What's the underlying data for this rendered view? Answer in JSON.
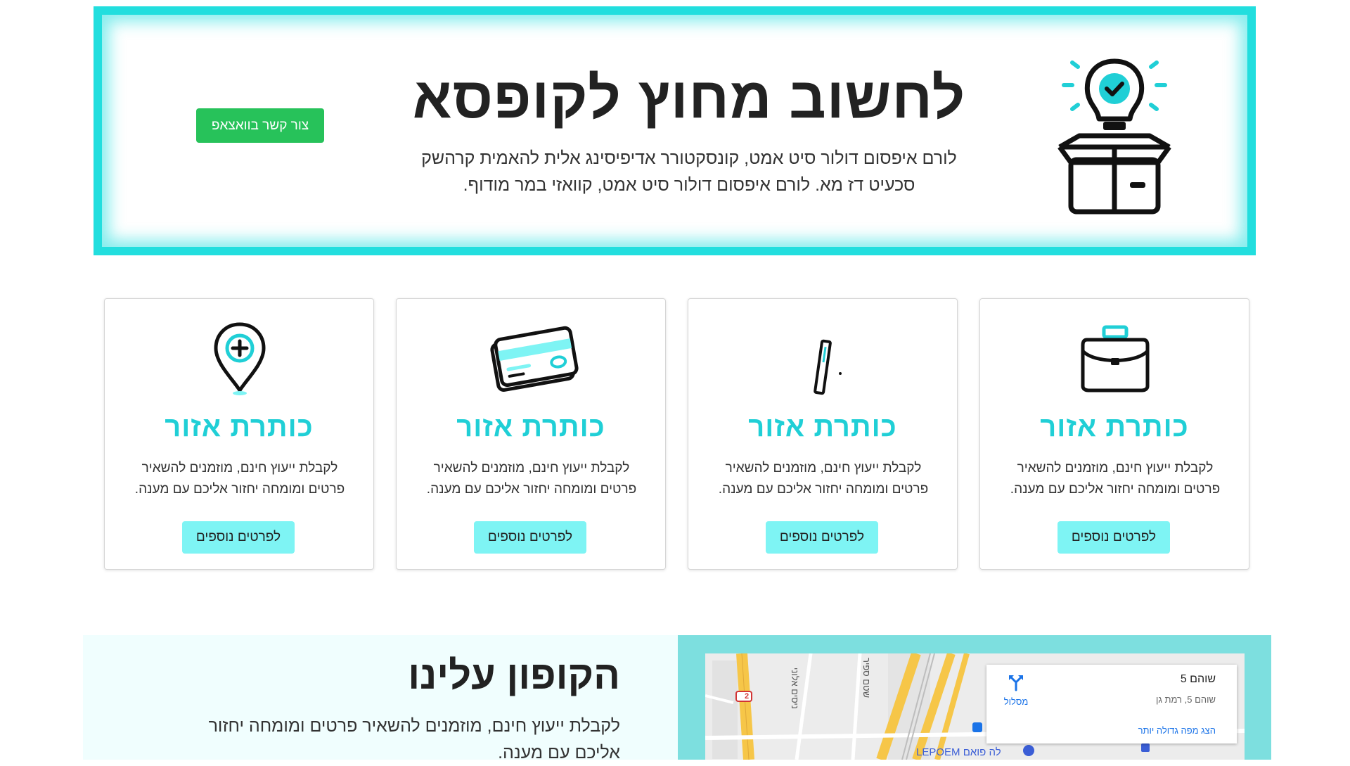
{
  "hero": {
    "title": "לחשוב מחוץ לקופסא",
    "text": "לורם איפסום דולור סיט אמט, קונסקטורר אדיפיסינג אלית להאמית קרהשק סכעיט דז מא. לורם איפסום דולור סיט אמט, קוואזי במר מודוף.",
    "whatsapp_label": "צור קשר בוואצאפ",
    "icon": "lightbulb-box-icon"
  },
  "colors": {
    "accent": "#22dede",
    "card_title": "#20cfd6",
    "card_button": "#7ef4f4",
    "whatsapp": "#27c25a",
    "map_bg": "#7ddfdf",
    "coupon_bg": "#f0fefe"
  },
  "cards": [
    {
      "icon": "briefcase-icon",
      "title": "כותרת אזור",
      "text": "לקבלת ייעוץ חינם, מוזמנים להשאיר פרטים ומומחה יחזור אליכם עם מענה.",
      "button": "לפרטים נוספים"
    },
    {
      "icon": "pen-icon",
      "title": "כותרת אזור",
      "text": "לקבלת ייעוץ חינם, מוזמנים להשאיר פרטים ומומחה יחזור אליכם עם מענה.",
      "button": "לפרטים נוספים"
    },
    {
      "icon": "credit-card-icon",
      "title": "כותרת אזור",
      "text": "לקבלת ייעוץ חינם, מוזמנים להשאיר פרטים ומומחה יחזור אליכם עם מענה.",
      "button": "לפרטים נוספים"
    },
    {
      "icon": "location-pin-plus-icon",
      "title": "כותרת אזור",
      "text": "לקבלת ייעוץ חינם, מוזמנים להשאיר פרטים ומומחה יחזור אליכם עם מענה.",
      "button": "לפרטים נוספים"
    }
  ],
  "coupon": {
    "title": "הקופון עלינו",
    "text": "לקבלת ייעוץ חינם, מוזמנים להשאיר פרטים ומומחה יחזור אליכם עם מענה."
  },
  "map": {
    "place_title": "שוהם 5",
    "place_address": "שוהם 5, רמת גן",
    "directions_label": "מסלול",
    "larger_map_link": "הצג מפה גדולה יותר",
    "road_badge": "2",
    "street_1": "ניסים אלוני",
    "street_2": "שטם ספיר",
    "poi_label": "LEPOEM לה פואם"
  }
}
